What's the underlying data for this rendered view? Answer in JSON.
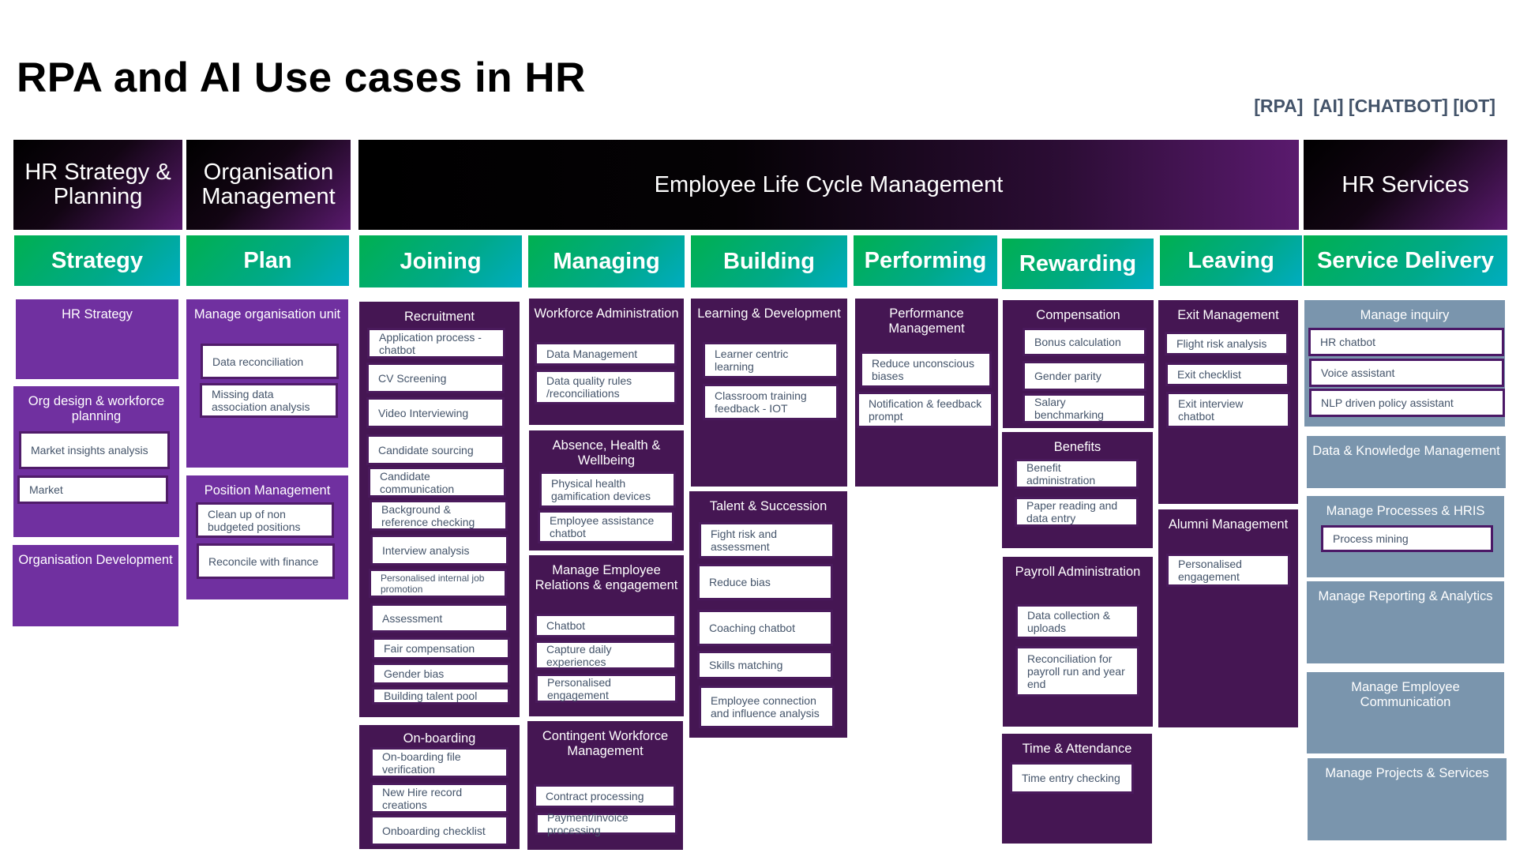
{
  "title": "RPA and AI Use cases in HR",
  "tags": "[RPA]  [AI] [CHATBOT] [IOT]",
  "domains": [
    {
      "label": "HR Strategy & Planning"
    },
    {
      "label": "Organisation Management"
    },
    {
      "label": "Employee Life Cycle Management"
    },
    {
      "label": "HR Services"
    }
  ],
  "phases": [
    "Strategy",
    "Plan",
    "Joining",
    "Managing",
    "Building",
    "Performing",
    "Rewarding",
    "Leaving",
    "Service Delivery"
  ],
  "columns": {
    "strategy": [
      {
        "title": "HR Strategy",
        "items": []
      },
      {
        "title": "Org design & workforce planning",
        "items": [
          "Market insights analysis",
          "Market"
        ]
      },
      {
        "title": "Organisation Development",
        "items": []
      }
    ],
    "plan": [
      {
        "title": "Manage organisation unit",
        "items": [
          "Data reconciliation",
          "Missing data association analysis"
        ]
      },
      {
        "title": "Position Management",
        "items": [
          "Clean up of non budgeted positions",
          "Reconcile with finance"
        ]
      }
    ],
    "joining": [
      {
        "title": "Recruitment",
        "items": [
          "Application process - chatbot",
          "CV Screening",
          "Video Interviewing",
          "Candidate sourcing",
          "Candidate communication",
          "Background & reference checking",
          "Interview analysis",
          "Personalised internal job promotion",
          "Assessment",
          "Fair compensation",
          "Gender bias",
          "Building talent pool"
        ]
      },
      {
        "title": "On-boarding",
        "items": [
          "On-boarding file verification",
          "New Hire record creations",
          "Onboarding checklist"
        ]
      }
    ],
    "managing": [
      {
        "title": "Workforce Administration",
        "items": [
          "Data Management",
          "Data quality rules /reconciliations"
        ]
      },
      {
        "title": "Absence, Health & Wellbeing",
        "items": [
          "Physical health gamification devices",
          "Employee assistance chatbot"
        ]
      },
      {
        "title": "Manage Employee Relations & engagement",
        "items": [
          "Chatbot",
          "Capture daily experiences",
          "Personalised engagement"
        ]
      },
      {
        "title": "Contingent Workforce Management",
        "items": [
          "Contract processing",
          "Payment/invoice processing"
        ]
      }
    ],
    "building": [
      {
        "title": "Learning & Development",
        "items": [
          "Learner centric learning",
          "Classroom training feedback - IOT"
        ]
      },
      {
        "title": "Talent & Succession",
        "items": [
          "Fight risk and assessment",
          "Reduce bias",
          "Coaching chatbot",
          "Skills matching",
          "Employee connection and influence analysis"
        ]
      }
    ],
    "performing": [
      {
        "title": "Performance Management",
        "items": [
          "Reduce unconscious biases",
          "Notification & feedback prompt"
        ]
      }
    ],
    "rewarding": [
      {
        "title": "Compensation",
        "items": [
          "Bonus calculation",
          "Gender parity",
          "Salary benchmarking"
        ]
      },
      {
        "title": "Benefits",
        "items": [
          "Benefit administration",
          "Paper reading and data entry"
        ]
      },
      {
        "title": "Payroll Administration",
        "items": [
          "Data collection & uploads",
          "Reconciliation for payroll run and year end"
        ]
      },
      {
        "title": "Time & Attendance",
        "items": [
          "Time entry checking"
        ]
      }
    ],
    "leaving": [
      {
        "title": "Exit Management",
        "items": [
          "Flight risk analysis",
          "Exit checklist",
          "Exit interview chatbot"
        ]
      },
      {
        "title": "Alumni Management",
        "items": [
          "Personalised engagement"
        ]
      }
    ],
    "service": [
      {
        "title": "Manage inquiry",
        "items": [
          "HR chatbot",
          "Voice assistant",
          "NLP driven policy assistant"
        ]
      },
      {
        "title": "Data & Knowledge Management",
        "items": []
      },
      {
        "title": "Manage Processes & HRIS",
        "items": [
          "Process mining"
        ]
      },
      {
        "title": "Manage Reporting & Analytics",
        "items": []
      },
      {
        "title": "Manage Employee Communication",
        "items": []
      },
      {
        "title": "Manage Projects & Services",
        "items": []
      }
    ]
  }
}
